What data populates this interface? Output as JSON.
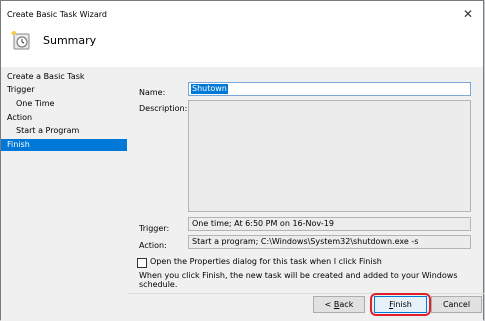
{
  "window": {
    "title": "Create Basic Task Wizard",
    "header_title": "Summary",
    "header_icon": "clock-icon"
  },
  "sidebar": {
    "items": [
      {
        "label": "Create a Basic Task",
        "selected": false
      },
      {
        "label": "Trigger",
        "selected": false
      },
      {
        "label": "One Time",
        "selected": false
      },
      {
        "label": "Action",
        "selected": false
      },
      {
        "label": "Start a Program",
        "selected": false
      },
      {
        "label": "Finish",
        "selected": true
      }
    ]
  },
  "summary": {
    "name_label": "Name:",
    "name_value": "Shutown",
    "description_label": "Description:",
    "description_value": "",
    "trigger_label": "Trigger:",
    "trigger_value": "One time; At 6:50 PM on 16-Nov-19",
    "action_label": "Action:",
    "action_value": "Start a program; C:\\Windows\\System32\\shutdown.exe -s",
    "open_properties_label": "Open the Properties dialog for this task when I click Finish",
    "open_properties_checked": false,
    "finish_note": "When you click Finish, the new task will be created and added to your Windows schedule."
  },
  "buttons": {
    "back_prefix": "< ",
    "back_accel": "B",
    "back_rest": "ack",
    "finish_accel": "F",
    "finish_rest": "inish",
    "cancel": "Cancel"
  },
  "colors": {
    "selection": "#0078d7",
    "highlight_ring": "#e0202a"
  }
}
